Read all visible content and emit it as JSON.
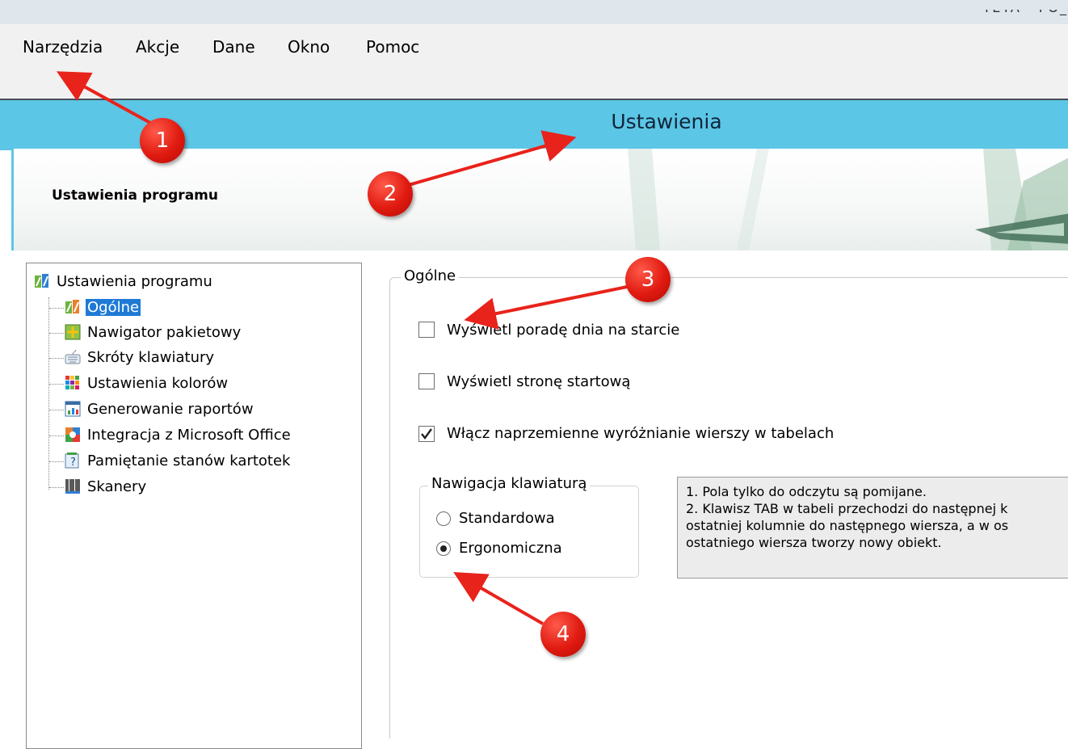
{
  "window": {
    "title_fragment": "TETA - PO_"
  },
  "menu": [
    "Narzędzia",
    "Akcje",
    "Dane",
    "Okno",
    "Pomoc"
  ],
  "header": {
    "title": "Ustawienia"
  },
  "banner": {
    "title": "Ustawienia programu"
  },
  "tree": {
    "root": "Ustawienia programu",
    "items": [
      {
        "label": "Ogólne",
        "icon": "settings-icon",
        "selected": true
      },
      {
        "label": "Nawigator pakietowy",
        "icon": "navigator-icon"
      },
      {
        "label": "Skróty klawiatury",
        "icon": "keyboard-icon"
      },
      {
        "label": "Ustawienia kolorów",
        "icon": "colors-icon"
      },
      {
        "label": "Generowanie raportów",
        "icon": "report-icon"
      },
      {
        "label": "Integracja z Microsoft Office",
        "icon": "office-icon"
      },
      {
        "label": "Pamiętanie stanów kartotek",
        "icon": "state-icon"
      },
      {
        "label": "Skanery",
        "icon": "barcode-icon"
      }
    ]
  },
  "general": {
    "legend": "Ogólne",
    "options": [
      {
        "label": "Wyświetl poradę dnia na starcie",
        "checked": false
      },
      {
        "label": "Wyświetl stronę startową",
        "checked": false
      },
      {
        "label": "Włącz naprzemienne wyróżnianie wierszy w tabelach",
        "checked": true
      }
    ]
  },
  "keyboard_nav": {
    "legend": "Nawigacja klawiaturą",
    "options": [
      {
        "label": "Standardowa",
        "selected": false
      },
      {
        "label": "Ergonomiczna",
        "selected": true
      }
    ]
  },
  "info": {
    "lines": [
      "1. Pola tylko do odczytu są pomijane.",
      "2. Klawisz TAB w tabeli przechodzi do następnej k",
      "ostatniej kolumnie do następnego wiersza, a w os",
      "ostatniego wiersza tworzy nowy obiekt."
    ]
  },
  "annotations": [
    "1",
    "2",
    "3",
    "4"
  ],
  "colors": {
    "header_blue": "#5cc6e6",
    "badge_red": "#e01a10",
    "arrow_red": "#e8231b",
    "selection": "#1f7ad6"
  }
}
